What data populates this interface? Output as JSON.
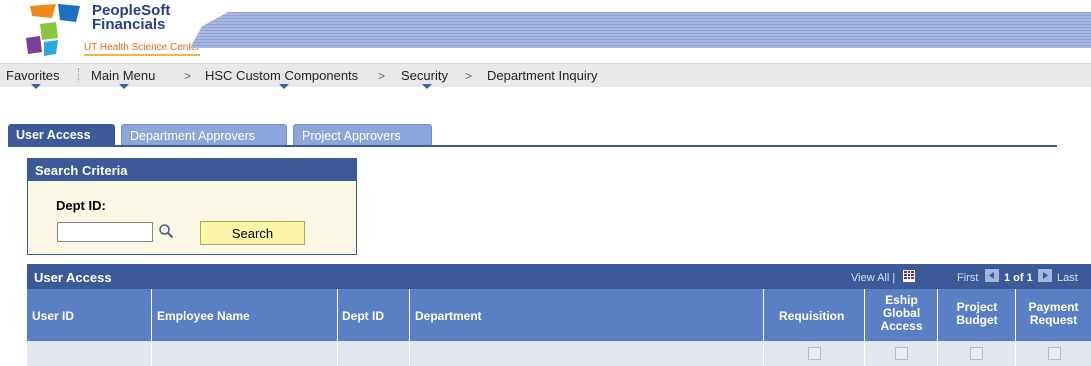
{
  "header": {
    "brand_line1": "PeopleSoft",
    "brand_line2": "Financials",
    "org": "UT Health Science Center"
  },
  "nav": {
    "favorites": "Favorites",
    "main_menu": "Main Menu",
    "custom": "HSC Custom Components",
    "security": "Security",
    "page": "Department Inquiry",
    "sep": ">"
  },
  "tabs": [
    {
      "label": "User Access"
    },
    {
      "label": "Department Approvers"
    },
    {
      "label": "Project Approvers"
    }
  ],
  "search": {
    "title": "Search Criteria",
    "dept_label": "Dept ID:",
    "dept_value": "",
    "button": "Search"
  },
  "grid": {
    "title": "User Access",
    "view_all": "View All |",
    "first": "First",
    "count": "1 of 1",
    "last": "Last",
    "columns": {
      "user_id": "User ID",
      "employee_name": "Employee Name",
      "dept_id": "Dept ID",
      "department": "Department",
      "requisition": "Requisition",
      "eship_1": "Eship",
      "eship_2": "Global",
      "eship_3": "Access",
      "project_1": "Project",
      "project_2": "Budget",
      "payment_1": "Payment",
      "payment_2": "Request"
    },
    "rows": [
      {
        "user_id": "",
        "employee_name": "",
        "dept_id": "",
        "department": "",
        "requisition": false,
        "eship_global_access": false,
        "project_budget": false,
        "payment_request": false
      }
    ]
  },
  "colors": {
    "primary": "#3c5a97",
    "column_header": "#5b7fc4",
    "search_button": "#fbf5a7",
    "search_bg": "#fbf8e6",
    "brand": "#2a3c8c",
    "org": "#e46a1a"
  }
}
